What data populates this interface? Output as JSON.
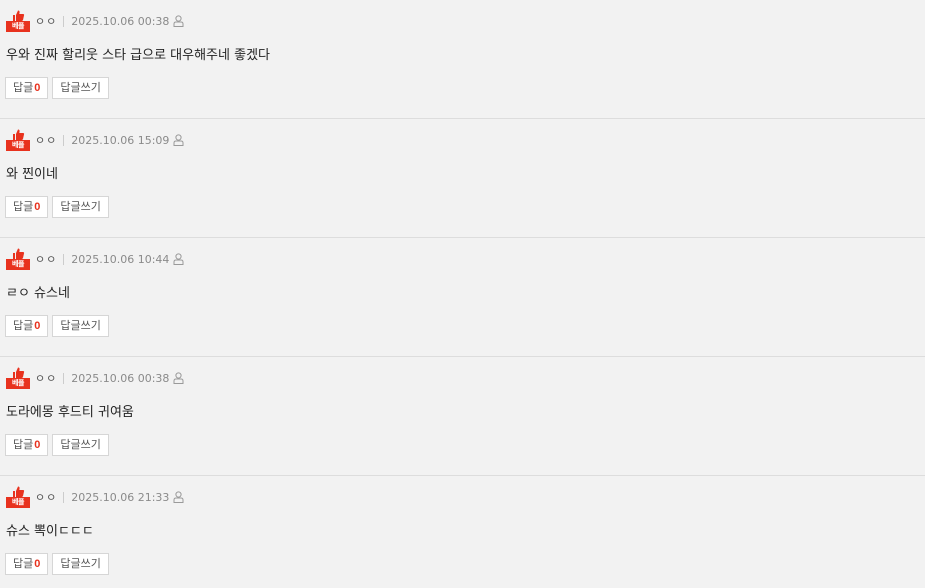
{
  "comments": [
    {
      "badge": "베플",
      "nickname": "ㅇㅇ",
      "datetime": "2025.10.06 00:38",
      "text": "우와 진짜 할리웃 스타 급으로 대우해주네 좋겠다",
      "reply_label": "답글",
      "reply_count": "0",
      "write_reply_label": "답글쓰기"
    },
    {
      "badge": "베플",
      "nickname": "ㅇㅇ",
      "datetime": "2025.10.06 15:09",
      "text": "와 찐이네",
      "reply_label": "답글",
      "reply_count": "0",
      "write_reply_label": "답글쓰기"
    },
    {
      "badge": "베플",
      "nickname": "ㅇㅇ",
      "datetime": "2025.10.06 10:44",
      "text": "ㄹㅇ 슈스네",
      "reply_label": "답글",
      "reply_count": "0",
      "write_reply_label": "답글쓰기"
    },
    {
      "badge": "베플",
      "nickname": "ㅇㅇ",
      "datetime": "2025.10.06 00:38",
      "text": "도라에몽 후드티 귀여움",
      "reply_label": "답글",
      "reply_count": "0",
      "write_reply_label": "답글쓰기"
    },
    {
      "badge": "베플",
      "nickname": "ㅇㅇ",
      "datetime": "2025.10.06 21:33",
      "text": "슈스 뽁이ㄷㄷㄷ",
      "reply_label": "답글",
      "reply_count": "0",
      "write_reply_label": "답글쓰기"
    }
  ],
  "icons": {
    "badge": "thumbs-up-icon",
    "report": "person-icon"
  },
  "colors": {
    "accent": "#e8321e",
    "background": "#f2f2f2"
  }
}
